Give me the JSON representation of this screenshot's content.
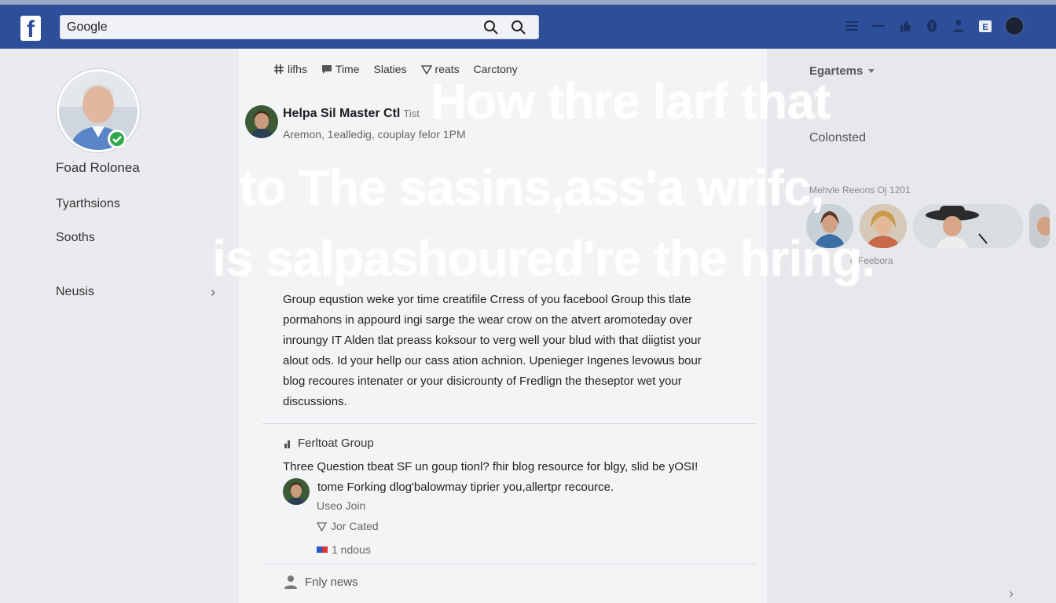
{
  "header": {
    "search_value": "Google",
    "search_icons": [
      "search-icon",
      "search-icon"
    ],
    "right_icons": [
      "menu-icon",
      "minus-icon",
      "thumb-icon",
      "info-icon",
      "people-icon",
      "notification-icon",
      "avatar"
    ]
  },
  "sidebar": {
    "profile_name": "Foad Rolonea",
    "items": [
      {
        "label": "Tyarthsions"
      },
      {
        "label": "Sooths"
      },
      {
        "label": "Neusis"
      }
    ]
  },
  "tabs": [
    {
      "label": "lifhs",
      "icon": "hashtag-icon"
    },
    {
      "label": "Time",
      "icon": "chat-icon"
    },
    {
      "label": "Slaties",
      "icon": ""
    },
    {
      "label": "reats",
      "icon": "heart-icon"
    },
    {
      "label": "Carctony",
      "icon": ""
    }
  ],
  "post": {
    "author": "Helpa Sil Master Ctl",
    "tag": "Tist",
    "meta": "Aremon, 1ealledig, couplay felor 1PM",
    "body_lines": [
      "Group equstion weke yor time creatifile Crress of you facebool Group this tlate",
      "pormahons in appourd ingi sarge the wear crow on the atvert aromoteday over",
      "inroungy IT Alden tlat preass koksour to verg well your blud with that diigtist your",
      "alout ods. Id your hellp our cass ation achnion. Upenieger Ingenes levowus bour",
      "blog recoures intenater or your disicrounty of Fredlign the theseptor wet your",
      "discussions."
    ]
  },
  "group": {
    "title": "Ferltoat Group",
    "question": "Three Question tbeat SF un goup tionl? fhir blog resource for blgy, slid be yOSI!",
    "comment_text": "tome Forking dlog'balowmay tiprier you,allertpr recource.",
    "comment_sub": "Useo Join",
    "line1": "Jor Cated",
    "line2": "1 ndous",
    "footer": "Fnly news"
  },
  "right": {
    "heading": "Egartems",
    "subheading": "Colonsted",
    "small_label": "Mehvle Reeons Oj 1201",
    "footer_label": "o Feebora"
  },
  "overlay": {
    "line1": "How thre larf that",
    "line2": "to The sasins,ass'a wrifc,",
    "line3": "is salpashoured're the hring."
  },
  "colors": {
    "topbar": "#2d4f99",
    "online": "#2eaa4b",
    "page_bg": "#e9ebee"
  }
}
